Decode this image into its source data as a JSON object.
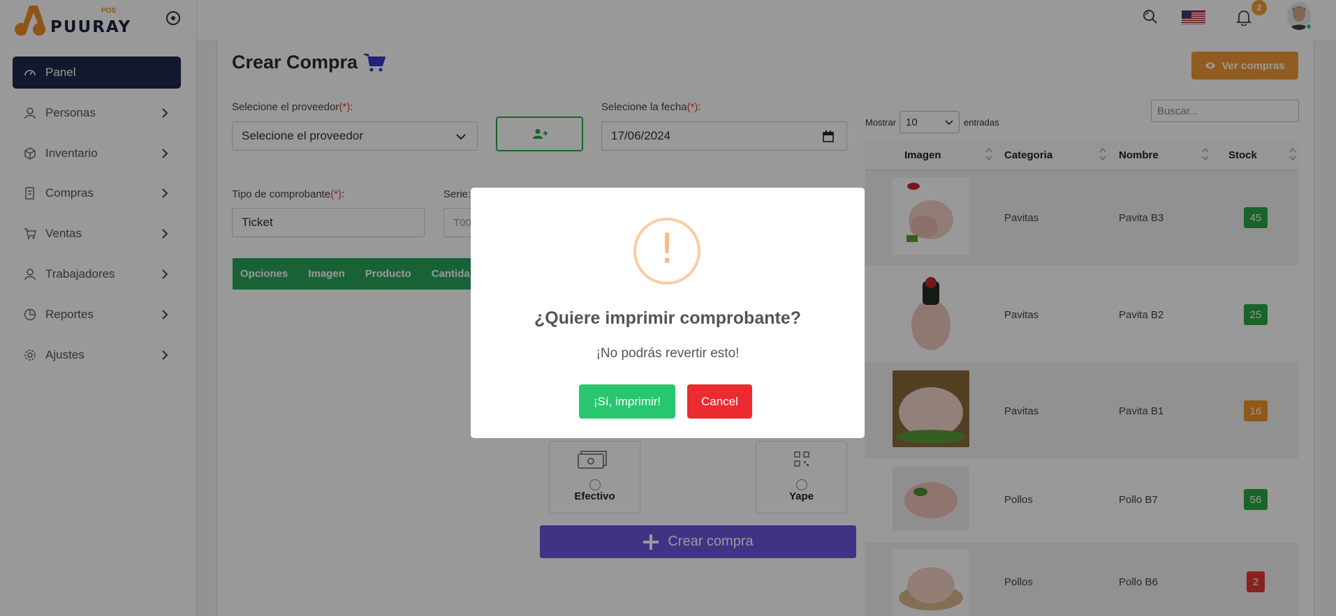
{
  "brand": {
    "name": "PUURAY",
    "tag": "POS"
  },
  "sidebar": {
    "items": [
      {
        "label": "Panel",
        "icon": "dashboard-icon",
        "active": true
      },
      {
        "label": "Personas",
        "icon": "user-icon"
      },
      {
        "label": "Inventario",
        "icon": "box-icon"
      },
      {
        "label": "Compras",
        "icon": "receipt-icon"
      },
      {
        "label": "Ventas",
        "icon": "cart-icon"
      },
      {
        "label": "Trabajadores",
        "icon": "user-icon"
      },
      {
        "label": "Reportes",
        "icon": "pie-chart-icon"
      },
      {
        "label": "Ajustes",
        "icon": "gear-icon"
      }
    ]
  },
  "topbar": {
    "notifications_count": "2"
  },
  "page": {
    "title": "Crear Compra",
    "ver_compras_label": "Ver compras"
  },
  "form": {
    "proveedor_label": "Selecione el proveedor",
    "proveedor_value": "Selecione el proveedor",
    "fecha_label": "Selecione la fecha",
    "fecha_value": "17/06/2024",
    "comprobante_label": "Tipo de comprobante",
    "comprobante_value": "Ticket",
    "serie_label": "Serie:",
    "serie_placeholder": "T00",
    "required_mark": "(*)",
    "suffix": ":"
  },
  "items_table": {
    "headers": [
      "Opciones",
      "Imagen",
      "Producto",
      "Cantida"
    ]
  },
  "payment": {
    "efectivo_label": "Efectivo",
    "yape_label": "Yape"
  },
  "crear_compra_label": "Crear compra",
  "products": {
    "show_label": "Mostrar",
    "entries_value": "10",
    "entries_label": "entradas",
    "search_placeholder": "Buscar...",
    "headers": [
      "Imagen",
      "Categoria",
      "Nombre",
      "Stock"
    ],
    "rows": [
      {
        "categoria": "Pavitas",
        "nombre": "Pavita B3",
        "stock": "45",
        "stock_color": "#28a745"
      },
      {
        "categoria": "Pavitas",
        "nombre": "Pavita B2",
        "stock": "25",
        "stock_color": "#28a745"
      },
      {
        "categoria": "Pavitas",
        "nombre": "Pavita B1",
        "stock": "16",
        "stock_color": "#f0932b"
      },
      {
        "categoria": "Pollos",
        "nombre": "Pollo B7",
        "stock": "56",
        "stock_color": "#28a745"
      },
      {
        "categoria": "Pollos",
        "nombre": "Pollo B6",
        "stock": "2",
        "stock_color": "#e53935"
      }
    ]
  },
  "modal": {
    "icon": "!",
    "title": "¿Quiere imprimir comprobante?",
    "text": "¡No podrás revertir esto!",
    "confirm_label": "¡Sí, imprimir!",
    "cancel_label": "Cancel"
  }
}
